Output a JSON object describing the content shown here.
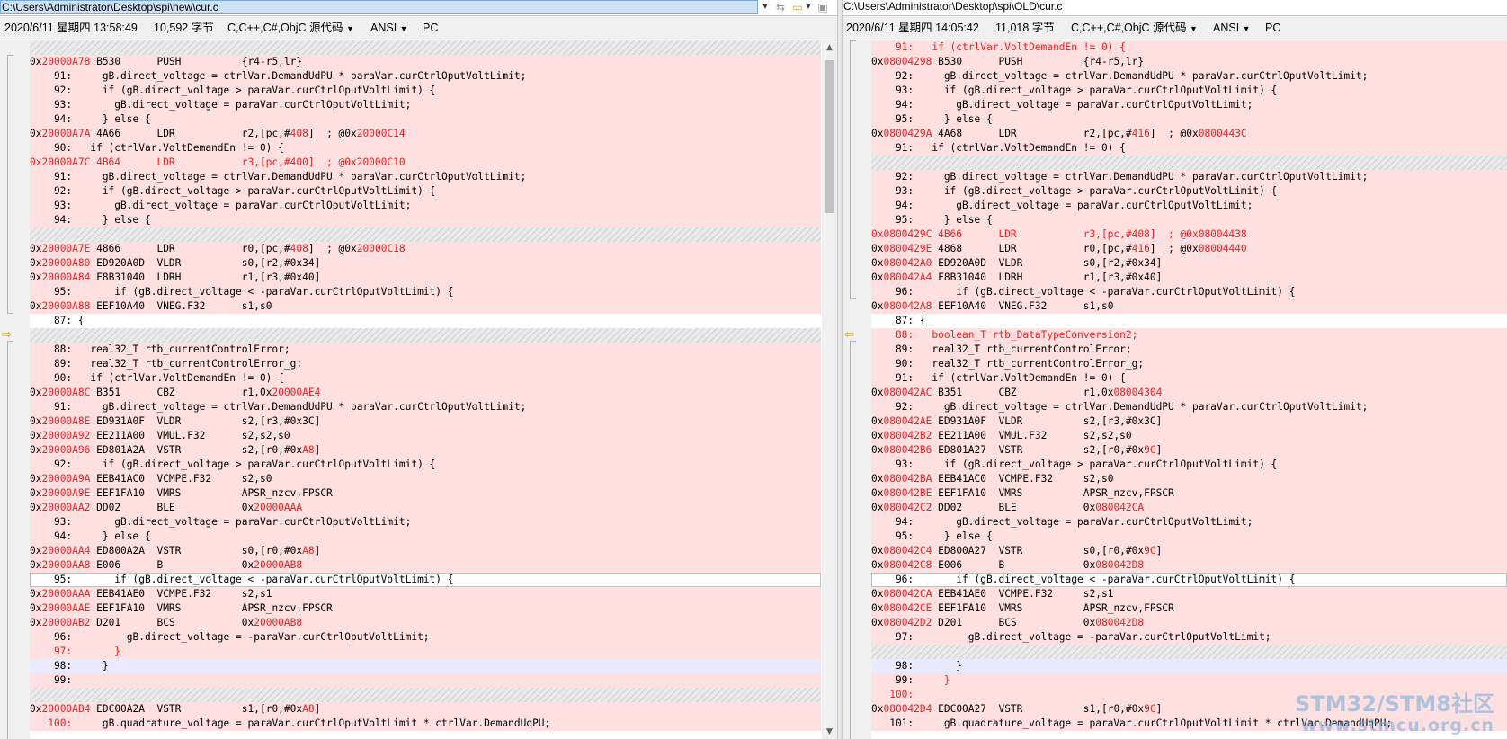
{
  "left": {
    "path": "C:\\Users\\Administrator\\Desktop\\spi\\new\\cur.c",
    "date": "2020/6/11 星期四 13:58:49",
    "size": "10,592 字节",
    "language": "C,C++,C#,ObjC 源代码",
    "encoding": "ANSI",
    "line_ending": "PC",
    "lines": [
      {
        "t": "gap",
        "s": [
          ""
        ]
      },
      {
        "t": "diff",
        "s": [
          "0x",
          "20000A78",
          " B530      PUSH          {r4-r5,lr}"
        ]
      },
      {
        "t": "diff",
        "s": [
          "    91:     gB.direct_voltage = ctrlVar.DemandUdPU * paraVar.curCtrlOputVoltLimit;"
        ]
      },
      {
        "t": "diff",
        "s": [
          "    92:     if (gB.direct_voltage > paraVar.curCtrlOputVoltLimit) {"
        ]
      },
      {
        "t": "diff",
        "s": [
          "    93:       gB.direct_voltage = paraVar.curCtrlOputVoltLimit;"
        ]
      },
      {
        "t": "diff",
        "s": [
          "    94:     } else {"
        ]
      },
      {
        "t": "diff",
        "s": [
          "0x",
          "20000A7A",
          " 4A66      LDR           r2,[pc,#",
          "408",
          "]  ; @0x",
          "20000C14"
        ]
      },
      {
        "t": "diff",
        "s": [
          "    90:   if (ctrlVar.VoltDemandEn != 0) {"
        ]
      },
      {
        "t": "diff",
        "s": [
          "",
          "0x20000A7C 4B64      LDR           r3,[pc,#400]  ; @0x20000C10"
        ]
      },
      {
        "t": "diff",
        "s": [
          "    91:     gB.direct_voltage = ctrlVar.DemandUdPU * paraVar.curCtrlOputVoltLimit;"
        ]
      },
      {
        "t": "diff",
        "s": [
          "    92:     if (gB.direct_voltage > paraVar.curCtrlOputVoltLimit) {"
        ]
      },
      {
        "t": "diff",
        "s": [
          "    93:       gB.direct_voltage = paraVar.curCtrlOputVoltLimit;"
        ]
      },
      {
        "t": "diff",
        "s": [
          "    94:     } else {"
        ]
      },
      {
        "t": "gap",
        "s": [
          ""
        ]
      },
      {
        "t": "diff",
        "s": [
          "0x",
          "20000A7E",
          " 4866      LDR           r0,[pc,#",
          "408",
          "]  ; @0x",
          "20000C18"
        ]
      },
      {
        "t": "diff",
        "s": [
          "0x",
          "20000A80",
          " ED920A0D  VLDR          s0,[r2,#0x34]"
        ]
      },
      {
        "t": "diff",
        "s": [
          "0x",
          "20000A84",
          " F8B31040  LDRH          r1,[r3,#0x40]"
        ]
      },
      {
        "t": "diff",
        "s": [
          "    95:       if (gB.direct_voltage < -paraVar.curCtrlOputVoltLimit) {"
        ]
      },
      {
        "t": "diff",
        "s": [
          "0x",
          "20000A88",
          " EEF10A40  VNEG.F32      s1,s0"
        ]
      },
      {
        "t": "same",
        "s": [
          "    87: {"
        ]
      },
      {
        "t": "gap",
        "s": [
          ""
        ]
      },
      {
        "t": "diff",
        "s": [
          "    88:   real32_T rtb_currentControlError;"
        ]
      },
      {
        "t": "diff",
        "s": [
          "    89:   real32_T rtb_currentControlError_g;"
        ]
      },
      {
        "t": "diff",
        "s": [
          "    90:   if (ctrlVar.VoltDemandEn != 0) {"
        ]
      },
      {
        "t": "diff",
        "s": [
          "0x",
          "20000A8C",
          " B351      CBZ           r1,0x",
          "20000AE4"
        ]
      },
      {
        "t": "diff",
        "s": [
          "    91:     gB.direct_voltage = ctrlVar.DemandUdPU * paraVar.curCtrlOputVoltLimit;"
        ]
      },
      {
        "t": "diff",
        "s": [
          "0x",
          "20000A8E",
          " ED931A0F  VLDR          s2,[r3,#0x3C]"
        ]
      },
      {
        "t": "diff",
        "s": [
          "0x",
          "20000A92",
          " EE211A00  VMUL.F32      s2,s2,s0"
        ]
      },
      {
        "t": "diff",
        "s": [
          "0x",
          "20000A96",
          " ED801A2A  VSTR          s2,[r0,#0x",
          "A8",
          "]"
        ]
      },
      {
        "t": "diff",
        "s": [
          "    92:     if (gB.direct_voltage > paraVar.curCtrlOputVoltLimit) {"
        ]
      },
      {
        "t": "diff",
        "s": [
          "0x",
          "20000A9A",
          " EEB41AC0  VCMPE.F32     s2,s0"
        ]
      },
      {
        "t": "diff",
        "s": [
          "0x",
          "20000A9E",
          " EEF1FA10  VMRS          APSR_nzcv,FPSCR"
        ]
      },
      {
        "t": "diff",
        "s": [
          "0x",
          "20000AA2",
          " DD02      BLE           0x",
          "20000AAA"
        ]
      },
      {
        "t": "diff",
        "s": [
          "    93:       gB.direct_voltage = paraVar.curCtrlOputVoltLimit;"
        ]
      },
      {
        "t": "diff",
        "s": [
          "    94:     } else {"
        ]
      },
      {
        "t": "diff",
        "s": [
          "0x",
          "20000AA4",
          " ED800A2A  VSTR          s0,[r0,#0x",
          "A8",
          "]"
        ]
      },
      {
        "t": "diff",
        "s": [
          "0x",
          "20000AA8",
          " E006      B             0x",
          "20000AB8"
        ]
      },
      {
        "t": "cur",
        "s": [
          "    95:       if (gB.direct_voltage < -paraVar.curCtrlOputVoltLimit) {"
        ]
      },
      {
        "t": "diff",
        "s": [
          "0x",
          "20000AAA",
          " EEB41AE0  VCMPE.F32     s2,s1"
        ]
      },
      {
        "t": "diff",
        "s": [
          "0x",
          "20000AAE",
          " EEF1FA10  VMRS          APSR_nzcv,FPSCR"
        ]
      },
      {
        "t": "diff",
        "s": [
          "0x",
          "20000AB2",
          " D201      BCS           0x",
          "20000AB8"
        ]
      },
      {
        "t": "diff",
        "s": [
          "    96:         gB.direct_voltage = -paraVar.curCtrlOputVoltLimit;"
        ]
      },
      {
        "t": "diff",
        "s": [
          "",
          "    97:       }"
        ]
      },
      {
        "t": "blank",
        "s": [
          "    98:     }"
        ]
      },
      {
        "t": "diff",
        "s": [
          "    99:"
        ]
      },
      {
        "t": "gap",
        "s": [
          ""
        ]
      },
      {
        "t": "diff",
        "s": [
          "0x",
          "20000AB4",
          " EDC00A2A  VSTR          s1,[r0,#0x",
          "A8",
          "]"
        ]
      },
      {
        "t": "diff",
        "s": [
          "   ",
          "100:",
          "     gB.quadrature_voltage = paraVar.curCtrlOputVoltLimit * ctrlVar.DemandUqPU;"
        ]
      }
    ]
  },
  "right": {
    "path": "C:\\Users\\Administrator\\Desktop\\spi\\OLD\\cur.c",
    "date": "2020/6/11 星期四 14:05:42",
    "size": "11,018 字节",
    "language": "C,C++,C#,ObjC 源代码",
    "encoding": "ANSI",
    "line_ending": "PC",
    "lines": [
      {
        "t": "diff",
        "s": [
          "",
          "    91:   if (ctrlVar.VoltDemandEn != 0) {"
        ]
      },
      {
        "t": "diff",
        "s": [
          "0x",
          "08004298",
          " B530      PUSH          {r4-r5,lr}"
        ]
      },
      {
        "t": "diff",
        "s": [
          "    92:     gB.direct_voltage = ctrlVar.DemandUdPU * paraVar.curCtrlOputVoltLimit;"
        ]
      },
      {
        "t": "diff",
        "s": [
          "    93:     if (gB.direct_voltage > paraVar.curCtrlOputVoltLimit) {"
        ]
      },
      {
        "t": "diff",
        "s": [
          "    94:       gB.direct_voltage = paraVar.curCtrlOputVoltLimit;"
        ]
      },
      {
        "t": "diff",
        "s": [
          "    95:     } else {"
        ]
      },
      {
        "t": "diff",
        "s": [
          "0x",
          "0800429A",
          " 4A68      LDR           r2,[pc,#",
          "416",
          "]  ; @0x",
          "0800443C"
        ]
      },
      {
        "t": "diff",
        "s": [
          "    91:   if (ctrlVar.VoltDemandEn != 0) {"
        ]
      },
      {
        "t": "gap",
        "s": [
          ""
        ]
      },
      {
        "t": "diff",
        "s": [
          "    92:     gB.direct_voltage = ctrlVar.DemandUdPU * paraVar.curCtrlOputVoltLimit;"
        ]
      },
      {
        "t": "diff",
        "s": [
          "    93:     if (gB.direct_voltage > paraVar.curCtrlOputVoltLimit) {"
        ]
      },
      {
        "t": "diff",
        "s": [
          "    94:       gB.direct_voltage = paraVar.curCtrlOputVoltLimit;"
        ]
      },
      {
        "t": "diff",
        "s": [
          "    95:     } else {"
        ]
      },
      {
        "t": "diff",
        "s": [
          "",
          "0x0800429C 4B66      LDR           r3,[pc,#408]  ; @0x08004438"
        ]
      },
      {
        "t": "diff",
        "s": [
          "0x",
          "0800429E",
          " 4868      LDR           r0,[pc,#",
          "416",
          "]  ; @0x",
          "08004440"
        ]
      },
      {
        "t": "diff",
        "s": [
          "0x",
          "080042A0",
          " ED920A0D  VLDR          s0,[r2,#0x34]"
        ]
      },
      {
        "t": "diff",
        "s": [
          "0x",
          "080042A4",
          " F8B31040  LDRH          r1,[r3,#0x40]"
        ]
      },
      {
        "t": "diff",
        "s": [
          "    96:       if (gB.direct_voltage < -paraVar.curCtrlOputVoltLimit) {"
        ]
      },
      {
        "t": "diff",
        "s": [
          "0x",
          "080042A8",
          " EEF10A40  VNEG.F32      s1,s0"
        ]
      },
      {
        "t": "same",
        "s": [
          "    87: {"
        ]
      },
      {
        "t": "diff",
        "s": [
          "",
          "    88:   boolean_T rtb_DataTypeConversion2;"
        ]
      },
      {
        "t": "diff",
        "s": [
          "    89:   real32_T rtb_currentControlError;"
        ]
      },
      {
        "t": "diff",
        "s": [
          "    90:   real32_T rtb_currentControlError_g;"
        ]
      },
      {
        "t": "diff",
        "s": [
          "    91:   if (ctrlVar.VoltDemandEn != 0) {"
        ]
      },
      {
        "t": "diff",
        "s": [
          "0x",
          "080042AC",
          " B351      CBZ           r1,0x",
          "08004304"
        ]
      },
      {
        "t": "diff",
        "s": [
          "    92:     gB.direct_voltage = ctrlVar.DemandUdPU * paraVar.curCtrlOputVoltLimit;"
        ]
      },
      {
        "t": "diff",
        "s": [
          "0x",
          "080042AE",
          " ED931A0F  VLDR          s2,[r3,#0x3C]"
        ]
      },
      {
        "t": "diff",
        "s": [
          "0x",
          "080042B2",
          " EE211A00  VMUL.F32      s2,s2,s0"
        ]
      },
      {
        "t": "diff",
        "s": [
          "0x",
          "080042B6",
          " ED801A27  VSTR          s2,[r0,#0x",
          "9C",
          "]"
        ]
      },
      {
        "t": "diff",
        "s": [
          "    93:     if (gB.direct_voltage > paraVar.curCtrlOputVoltLimit) {"
        ]
      },
      {
        "t": "diff",
        "s": [
          "0x",
          "080042BA",
          " EEB41AC0  VCMPE.F32     s2,s0"
        ]
      },
      {
        "t": "diff",
        "s": [
          "0x",
          "080042BE",
          " EEF1FA10  VMRS          APSR_nzcv,FPSCR"
        ]
      },
      {
        "t": "diff",
        "s": [
          "0x",
          "080042C2",
          " DD02      BLE           0x",
          "080042CA"
        ]
      },
      {
        "t": "diff",
        "s": [
          "    94:       gB.direct_voltage = paraVar.curCtrlOputVoltLimit;"
        ]
      },
      {
        "t": "diff",
        "s": [
          "    95:     } else {"
        ]
      },
      {
        "t": "diff",
        "s": [
          "0x",
          "080042C4",
          " ED800A27  VSTR          s0,[r0,#0x",
          "9C",
          "]"
        ]
      },
      {
        "t": "diff",
        "s": [
          "0x",
          "080042C8",
          " E006      B             0x",
          "080042D8"
        ]
      },
      {
        "t": "cur",
        "s": [
          "    96:       if (gB.direct_voltage < -paraVar.curCtrlOputVoltLimit) {"
        ]
      },
      {
        "t": "diff",
        "s": [
          "0x",
          "080042CA",
          " EEB41AE0  VCMPE.F32     s2,s1"
        ]
      },
      {
        "t": "diff",
        "s": [
          "0x",
          "080042CE",
          " EEF1FA10  VMRS          APSR_nzcv,FPSCR"
        ]
      },
      {
        "t": "diff",
        "s": [
          "0x",
          "080042D2",
          " D201      BCS           0x",
          "080042D8"
        ]
      },
      {
        "t": "diff",
        "s": [
          "    97:         gB.direct_voltage = -paraVar.curCtrlOputVoltLimit;"
        ]
      },
      {
        "t": "gap",
        "s": [
          ""
        ]
      },
      {
        "t": "blank",
        "s": [
          "    98:       }"
        ]
      },
      {
        "t": "diff",
        "s": [
          "    99:     ",
          "}"
        ]
      },
      {
        "t": "diff",
        "s": [
          "",
          "   100:"
        ]
      },
      {
        "t": "diff",
        "s": [
          "0x",
          "080042D4",
          " EDC00A27  VSTR          s1,[r0,#0x",
          "9C",
          "]"
        ]
      },
      {
        "t": "diff",
        "s": [
          "   101:     gB.quadrature_voltage = paraVar.curCtrlOputVoltLimit * ctrlVar.DemandUqPU;"
        ]
      }
    ]
  },
  "watermark": {
    "line1": "STM32/STM8社区",
    "line2": "www.stmcu.org.cn"
  },
  "icons": [
    "chevron-down-icon",
    "back-arrow-icon",
    "folder-open-icon",
    "save-icon",
    "scroll-up-icon",
    "scroll-down-icon",
    "sync-arrow-icon"
  ]
}
